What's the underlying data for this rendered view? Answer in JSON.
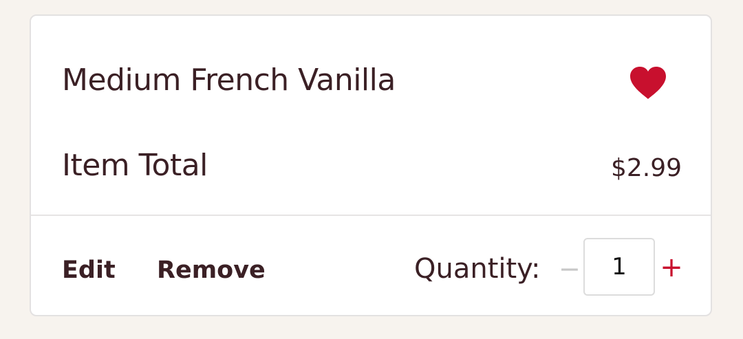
{
  "cart_item": {
    "name": "Medium French Vanilla",
    "favorite_icon": "heart-icon",
    "favorited": true,
    "total_label": "Item Total",
    "total_value": "$2.99",
    "edit_label": "Edit",
    "remove_label": "Remove",
    "quantity_label": "Quantity:",
    "quantity_value": "1",
    "minus_label": "−",
    "plus_label": "+"
  },
  "colors": {
    "background": "#f7f3ee",
    "text": "#3b2025",
    "heart": "#c8102e",
    "plus": "#c8102e",
    "minus_disabled": "#c7c7c7"
  }
}
